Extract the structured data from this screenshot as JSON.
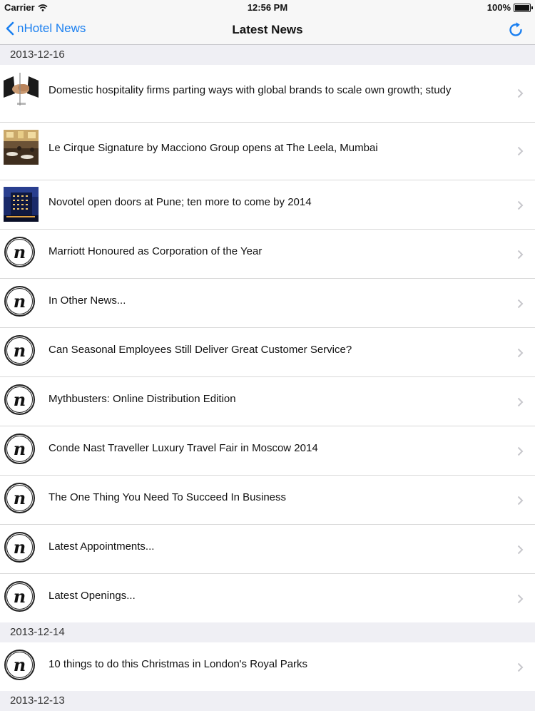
{
  "status_bar": {
    "carrier": "Carrier",
    "time": "12:56 PM",
    "battery": "100%"
  },
  "nav": {
    "back_label": "nHotel News",
    "title": "Latest News"
  },
  "colors": {
    "accent": "#1a7ff0",
    "section_bg": "#efeff4"
  },
  "sections": [
    {
      "date": "2013-12-16",
      "items": [
        {
          "title": "Domestic hospitality firms parting ways with global brands to scale own growth; study",
          "thumb": "handshake-photo"
        },
        {
          "title": "Le Cirque Signature by Macciono Group opens at The Leela, Mumbai",
          "thumb": "restaurant-photo"
        },
        {
          "title": "Novotel open doors at Pune; ten more to come by 2014",
          "thumb": "hotel-night-photo"
        },
        {
          "title": "Marriott Honoured as Corporation of the Year",
          "thumb": "nhotel-logo"
        },
        {
          "title": "In Other News...",
          "thumb": "nhotel-logo"
        },
        {
          "title": "Can Seasonal Employees Still Deliver Great Customer Service?",
          "thumb": "nhotel-logo"
        },
        {
          "title": "Mythbusters: Online Distribution Edition",
          "thumb": "nhotel-logo"
        },
        {
          "title": "Conde Nast Traveller Luxury Travel Fair in Moscow 2014",
          "thumb": "nhotel-logo"
        },
        {
          "title": "The One Thing You Need To Succeed In Business",
          "thumb": "nhotel-logo"
        },
        {
          "title": "Latest Appointments...",
          "thumb": "nhotel-logo"
        },
        {
          "title": "Latest Openings...",
          "thumb": "nhotel-logo"
        }
      ]
    },
    {
      "date": "2013-12-14",
      "items": [
        {
          "title": "10 things to do this Christmas in London's Royal Parks",
          "thumb": "nhotel-logo"
        }
      ]
    },
    {
      "date": "2013-12-13",
      "items": []
    }
  ]
}
